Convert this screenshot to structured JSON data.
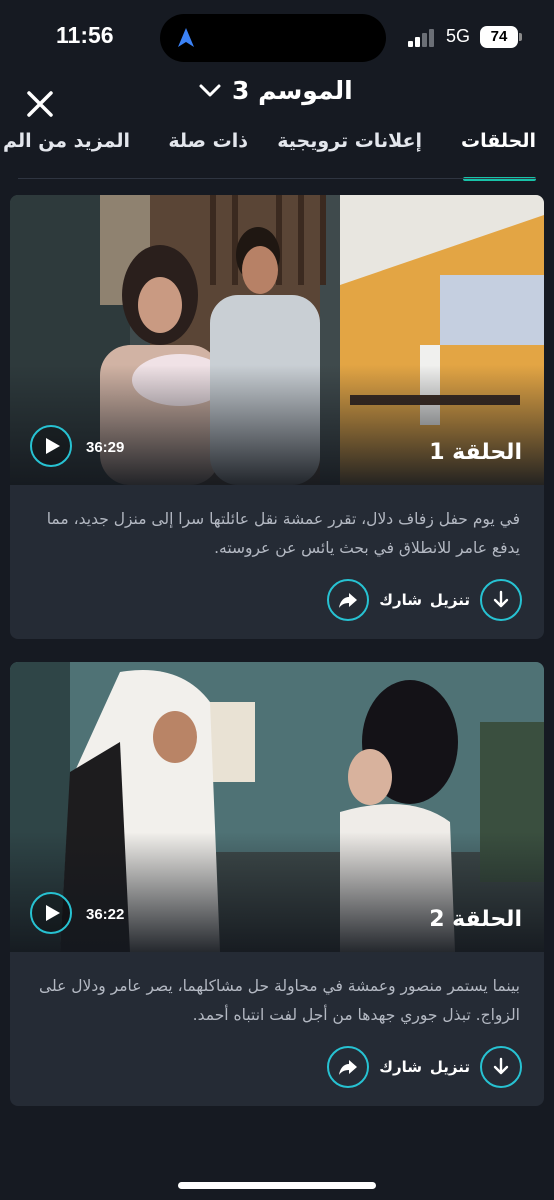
{
  "status_bar": {
    "time": "11:56",
    "network": "5G",
    "battery": "74"
  },
  "header": {
    "season_label": "الموسم 3",
    "close_icon": "close-icon",
    "chevron_icon": "chevron-down-icon"
  },
  "tabs": [
    {
      "label": "الحلقات",
      "active": true
    },
    {
      "label": "إعلانات ترويجية",
      "active": false
    },
    {
      "label": "ذات صلة",
      "active": false
    },
    {
      "label": "المزيد من الم",
      "active": false
    }
  ],
  "episodes": [
    {
      "title": "الحلقة 1",
      "duration": "36:29",
      "description": "في يوم حفل زفاف دلال، تقرر عمشة نقل عائلتها سرا إلى منزل جديد، مما يدفع عامر للانطلاق في بحث يائس عن عروسته.",
      "download_label": "تنزيل",
      "share_label": "شارك"
    },
    {
      "title": "الحلقة 2",
      "duration": "36:22",
      "description": "بينما يستمر منصور وعمشة في محاولة حل مشاكلهما، يصر عامر ودلال على الزواج. تبذل جوري جهدها من أجل لفت انتباه أحمد.",
      "download_label": "تنزيل",
      "share_label": "شارك"
    }
  ],
  "colors": {
    "accent": "#27c2d2",
    "tab_indicator": "#18c3a9",
    "background": "#161a22",
    "card": "#252b35"
  }
}
